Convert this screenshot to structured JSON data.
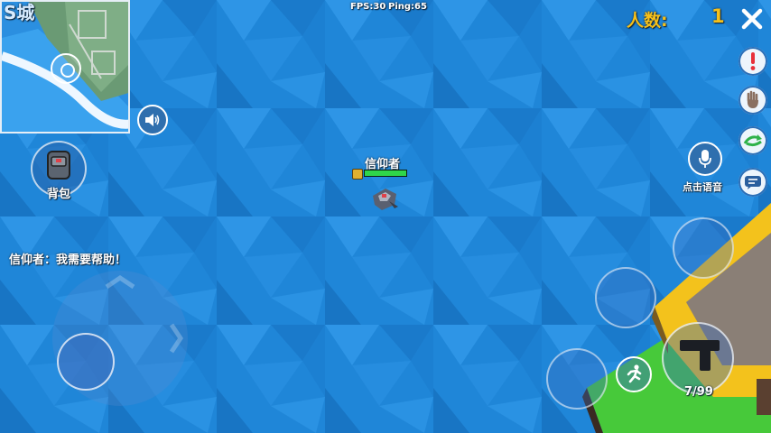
{
  "hud": {
    "fps_label": "FPS:30",
    "ping_label": "Ping:65",
    "player_count_label": "人数:",
    "player_count_value": "1"
  },
  "minimap": {
    "map_text": "S城"
  },
  "buttons": {
    "backpack_label": "背包",
    "voice_label": "点击语音"
  },
  "player": {
    "name": "信仰者",
    "health_fraction": 1.0
  },
  "chat": {
    "message": "信仰者：我需要帮助！"
  },
  "ammo": {
    "label": "7/99"
  },
  "colors": {
    "water": "#1f86d8",
    "hud_orange": "#f5c01a",
    "health_green": "#2fd64a",
    "island_grass": "#47c93a",
    "building_yellow": "#f3c21c",
    "building_roof": "#8a7f76"
  }
}
